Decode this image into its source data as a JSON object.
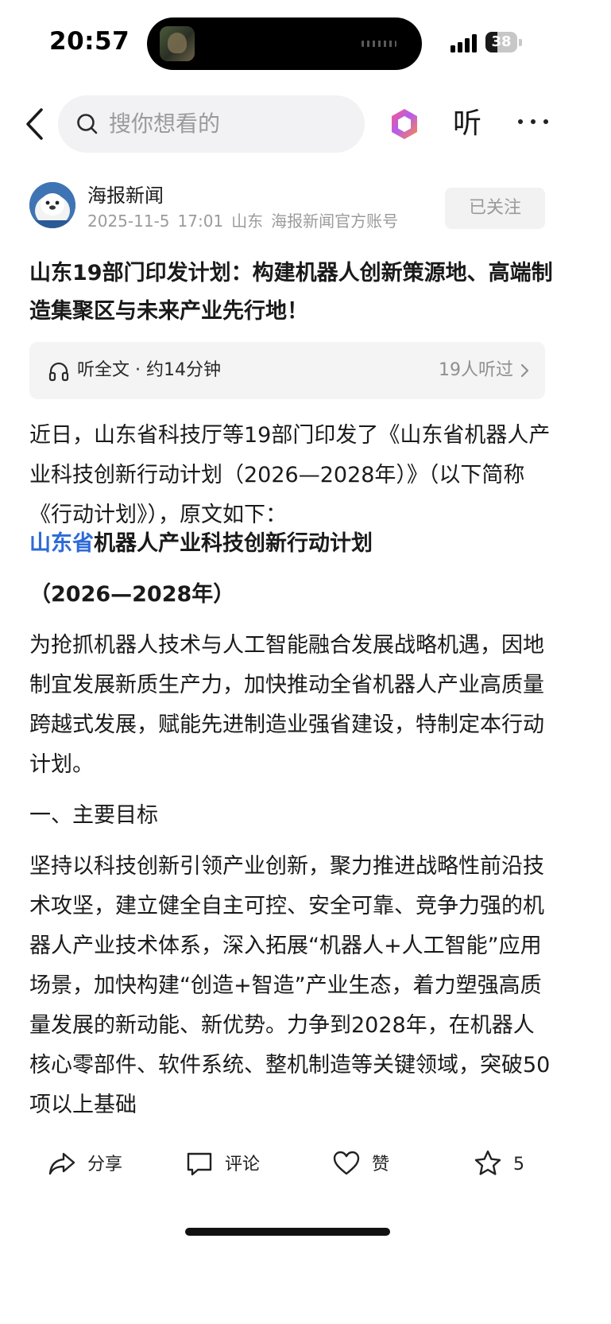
{
  "status_bar": {
    "time": "20:57",
    "battery": "38",
    "battery_level": 0.38
  },
  "nav": {
    "search_placeholder": "搜你想看的",
    "listen_label": "听"
  },
  "author": {
    "name": "海报新闻",
    "date": "2025-11-5",
    "time": "17:01",
    "location": "山东",
    "account_type": "海报新闻官方账号",
    "follow_label": "已关注"
  },
  "article": {
    "headline": "山东19部门印发计划：构建机器人创新策源地、高端制造集聚区与未来产业先行地！",
    "listen_bar": {
      "label": "听全文 · 约14分钟",
      "count": "19人听过"
    },
    "intro": "近日，山东省科技厅等19部门印发了《山东省机器人产业科技创新行动计划（2026—2028年）》（以下简称《行动计划》），原文如下：",
    "subtitle_link": "山东省",
    "subtitle_rest": "机器人产业科技创新行动计划",
    "subtitle_years": "（2026—2028年）",
    "para_purpose": "为抢抓机器人技术与人工智能融合发展战略机遇，因地制宜发展新质生产力，加快推动全省机器人产业高质量跨越式发展，赋能先进制造业强省建设，特制定本行动计划。",
    "section_heading": "一、主要目标",
    "para_goals": "坚持以科技创新引领产业创新，聚力推进战略性前沿技术攻坚，建立健全自主可控、安全可靠、竞争力强的机器人产业技术体系，深入拓展“机器人+人工智能”应用场景，加快构建“创造+智造”产业生态，着力塑强高质量发展的新动能、新优势。力争到2028年，在机器人核心零部件、软件系统、整机制造等关键领域，突破50项以上基础"
  },
  "bottom_bar": {
    "share": "分享",
    "comment": "评论",
    "like": "赞",
    "favorite_count": "5"
  },
  "colors": {
    "accent_blue": "#2c6ad8",
    "muted": "#9b9b9b"
  }
}
